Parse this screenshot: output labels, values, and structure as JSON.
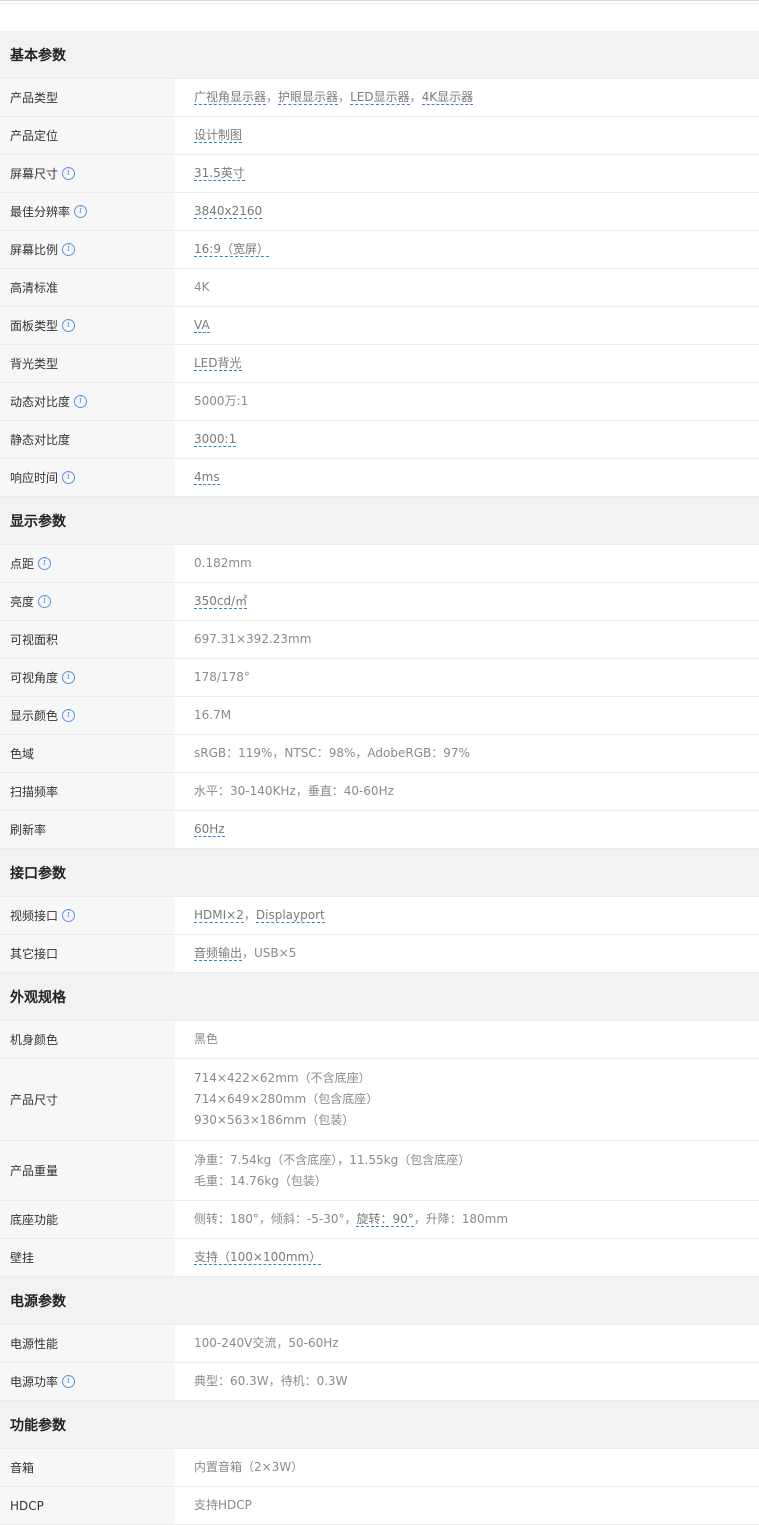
{
  "sections": [
    {
      "title": "基本参数",
      "rows": [
        {
          "label": "产品类型",
          "info": false,
          "h": 38,
          "lines": [
            [
              {
                "t": "广视角显示器",
                "l": true
              },
              {
                "t": "，",
                "l": false
              },
              {
                "t": "护眼显示器",
                "l": true
              },
              {
                "t": "，",
                "l": false
              },
              {
                "t": "LED显示器",
                "l": true
              },
              {
                "t": "，",
                "l": false
              },
              {
                "t": "4K显示器",
                "l": true
              }
            ]
          ]
        },
        {
          "label": "产品定位",
          "info": false,
          "h": 38,
          "lines": [
            [
              {
                "t": "设计制图",
                "l": true
              }
            ]
          ]
        },
        {
          "label": "屏幕尺寸",
          "info": true,
          "h": 38,
          "lines": [
            [
              {
                "t": "31.5英寸",
                "l": true
              }
            ]
          ]
        },
        {
          "label": "最佳分辨率",
          "info": true,
          "h": 38,
          "lines": [
            [
              {
                "t": "3840x2160",
                "l": true
              }
            ]
          ]
        },
        {
          "label": "屏幕比例",
          "info": true,
          "h": 38,
          "lines": [
            [
              {
                "t": "16:9（宽屏）",
                "l": true
              }
            ]
          ]
        },
        {
          "label": "高清标准",
          "info": false,
          "h": 38,
          "lines": [
            [
              {
                "t": "4K",
                "l": false
              }
            ]
          ]
        },
        {
          "label": "面板类型",
          "info": true,
          "h": 38,
          "lines": [
            [
              {
                "t": "VA",
                "l": true
              }
            ]
          ]
        },
        {
          "label": "背光类型",
          "info": false,
          "h": 38,
          "lines": [
            [
              {
                "t": "LED背光",
                "l": true
              }
            ]
          ]
        },
        {
          "label": "动态对比度",
          "info": true,
          "h": 38,
          "lines": [
            [
              {
                "t": "5000万:1",
                "l": false
              }
            ]
          ]
        },
        {
          "label": "静态对比度",
          "info": false,
          "h": 38,
          "lines": [
            [
              {
                "t": "3000:1",
                "l": true
              }
            ]
          ]
        },
        {
          "label": "响应时间",
          "info": true,
          "h": 38,
          "lines": [
            [
              {
                "t": "4ms",
                "l": true
              }
            ]
          ]
        }
      ]
    },
    {
      "title": "显示参数",
      "rows": [
        {
          "label": "点距",
          "info": true,
          "h": 38,
          "lines": [
            [
              {
                "t": "0.182mm",
                "l": false
              }
            ]
          ]
        },
        {
          "label": "亮度",
          "info": true,
          "h": 38,
          "lines": [
            [
              {
                "t": "350cd/㎡",
                "l": true
              }
            ]
          ]
        },
        {
          "label": "可视面积",
          "info": false,
          "h": 38,
          "lines": [
            [
              {
                "t": "697.31×392.23mm",
                "l": false
              }
            ]
          ]
        },
        {
          "label": "可视角度",
          "info": true,
          "h": 38,
          "lines": [
            [
              {
                "t": "178/178°",
                "l": false
              }
            ]
          ]
        },
        {
          "label": "显示颜色",
          "info": true,
          "h": 38,
          "lines": [
            [
              {
                "t": "16.7M",
                "l": false
              }
            ]
          ]
        },
        {
          "label": "色域",
          "info": false,
          "h": 38,
          "lines": [
            [
              {
                "t": "sRGB：119%，NTSC：98%，AdobeRGB：97%",
                "l": false
              }
            ]
          ]
        },
        {
          "label": "扫描频率",
          "info": false,
          "h": 38,
          "lines": [
            [
              {
                "t": "水平：30-140KHz，垂直：40-60Hz",
                "l": false
              }
            ]
          ]
        },
        {
          "label": "刷新率",
          "info": false,
          "h": 38,
          "lines": [
            [
              {
                "t": "60Hz",
                "l": true
              }
            ]
          ]
        }
      ]
    },
    {
      "title": "接口参数",
      "rows": [
        {
          "label": "视频接口",
          "info": true,
          "h": 38,
          "lines": [
            [
              {
                "t": "HDMI×2",
                "l": true
              },
              {
                "t": "，",
                "l": false
              },
              {
                "t": "Displayport",
                "l": true
              }
            ]
          ]
        },
        {
          "label": "其它接口",
          "info": false,
          "h": 38,
          "lines": [
            [
              {
                "t": "音频输出",
                "l": true
              },
              {
                "t": "，USB×5",
                "l": false
              }
            ]
          ]
        }
      ]
    },
    {
      "title": "外观规格",
      "rows": [
        {
          "label": "机身颜色",
          "info": false,
          "h": 38,
          "lines": [
            [
              {
                "t": "黑色",
                "l": false
              }
            ]
          ]
        },
        {
          "label": "产品尺寸",
          "info": false,
          "h": 82,
          "lines": [
            [
              {
                "t": "714×422×62mm（不含底座）",
                "l": false
              }
            ],
            [
              {
                "t": "714×649×280mm（包含底座）",
                "l": false
              }
            ],
            [
              {
                "t": "930×563×186mm（包装）",
                "l": false
              }
            ]
          ]
        },
        {
          "label": "产品重量",
          "info": false,
          "h": 60,
          "lines": [
            [
              {
                "t": "净重：7.54kg（不含底座），11.55kg（包含底座）",
                "l": false
              }
            ],
            [
              {
                "t": "毛重：14.76kg（包装）",
                "l": false
              }
            ]
          ]
        },
        {
          "label": "底座功能",
          "info": false,
          "h": 38,
          "lines": [
            [
              {
                "t": "侧转：180°，倾斜：-5-30°，",
                "l": false
              },
              {
                "t": "旋转：90°",
                "l": true
              },
              {
                "t": "，升降：180mm",
                "l": false
              }
            ]
          ]
        },
        {
          "label": "壁挂",
          "info": false,
          "h": 38,
          "lines": [
            [
              {
                "t": "支持（100×100mm）",
                "l": true
              }
            ]
          ]
        }
      ]
    },
    {
      "title": "电源参数",
      "rows": [
        {
          "label": "电源性能",
          "info": false,
          "h": 38,
          "lines": [
            [
              {
                "t": "100-240V交流，50-60Hz",
                "l": false
              }
            ]
          ]
        },
        {
          "label": "电源功率",
          "info": true,
          "h": 38,
          "lines": [
            [
              {
                "t": "典型：60.3W，待机：0.3W",
                "l": false
              }
            ]
          ]
        }
      ]
    },
    {
      "title": "功能参数",
      "rows": [
        {
          "label": "音箱",
          "info": false,
          "h": 38,
          "lines": [
            [
              {
                "t": "内置音箱（2×3W）",
                "l": false
              }
            ]
          ]
        },
        {
          "label": "HDCP",
          "info": false,
          "h": 38,
          "lines": [
            [
              {
                "t": "支持HDCP",
                "l": false
              }
            ]
          ]
        }
      ]
    }
  ],
  "info_icon_glyph": "i",
  "colors": {
    "link_underline": "#3a7fd0",
    "info_icon": "#5a95d6",
    "header_bg": "#f2f2f2",
    "label_bg": "#f7f7f7"
  }
}
